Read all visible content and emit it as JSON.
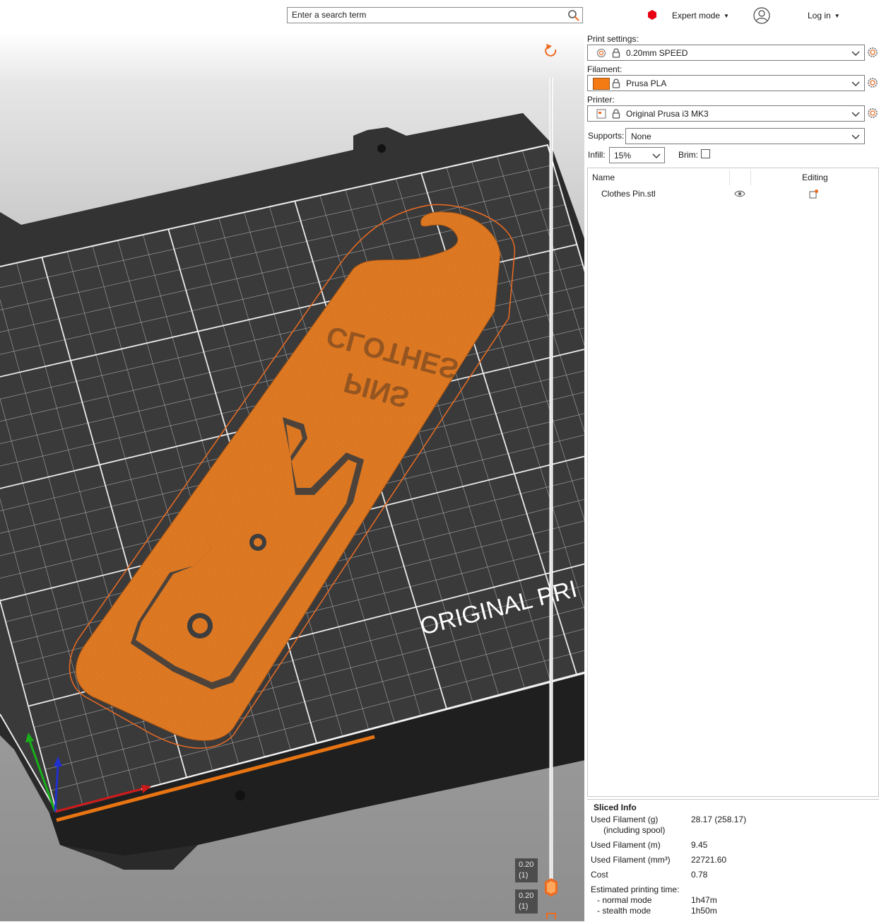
{
  "search": {
    "placeholder": "Enter a search term"
  },
  "header": {
    "mode_label": "Expert mode",
    "login_label": "Log in"
  },
  "viewport": {
    "bed_logo_text": "ORIGINAL PRI",
    "model_text_line1": "CLOTHES",
    "model_text_line2": "PINS",
    "layer_top": {
      "height": "0.20",
      "layer": "(1)"
    },
    "layer_bottom": {
      "height": "0.20",
      "layer": "(1)"
    }
  },
  "settings": {
    "print_label": "Print settings:",
    "print_value": "0.20mm SPEED",
    "filament_label": "Filament:",
    "filament_value": "Prusa PLA",
    "filament_color": "#f47b13",
    "printer_label": "Printer:",
    "printer_value": "Original Prusa i3 MK3",
    "supports_label": "Supports:",
    "supports_value": "None",
    "infill_label": "Infill:",
    "infill_value": "15%",
    "brim_label": "Brim:",
    "brim_checked": false
  },
  "object_list": {
    "col_name": "Name",
    "col_editing": "Editing",
    "items": [
      {
        "name": "Clothes Pin.stl"
      }
    ]
  },
  "sliced_info": {
    "title": "Sliced Info",
    "rows": [
      {
        "key": "Used Filament (g)",
        "sub": "(including spool)",
        "value": "28.17 (258.17)"
      },
      {
        "key": "Used Filament (m)",
        "value": "9.45"
      },
      {
        "key": "Used Filament (mm³)",
        "value": "22721.60"
      },
      {
        "key": "Cost",
        "value": "0.78"
      },
      {
        "key": "Estimated printing time:",
        "value": ""
      },
      {
        "key": "- normal mode",
        "value": "1h47m"
      },
      {
        "key": "- stealth mode",
        "value": "1h50m"
      }
    ]
  },
  "colors": {
    "accent": "#ed6b21",
    "bed": "#2e2e2e",
    "model": "#e07a23",
    "grid": "#ffffff"
  }
}
